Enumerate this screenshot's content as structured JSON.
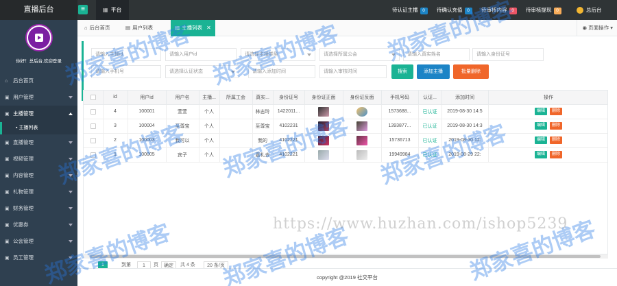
{
  "topbar": {
    "brand": "直播后台",
    "menu_icon": "hamburger-icon",
    "home_tab": "平台",
    "pending": [
      {
        "label": "待认证主播",
        "count": "0",
        "color": "#1c84c6"
      },
      {
        "label": "待确认充值",
        "count": "0",
        "color": "#1c84c6"
      },
      {
        "label": "待审核内容",
        "count": "0",
        "color": "#ed5565"
      },
      {
        "label": "待审核提现",
        "count": "0",
        "color": "#f8ac59"
      }
    ],
    "user": "总后台"
  },
  "sidebar": {
    "welcome": "你好！总后台,欢迎登录",
    "items": [
      {
        "label": "后台首页",
        "icon": "home-icon"
      },
      {
        "label": "用户管理",
        "icon": "user-icon"
      },
      {
        "label": "主播管理",
        "icon": "anchor-icon"
      },
      {
        "label": "直播管理",
        "icon": "live-icon"
      },
      {
        "label": "视频管理",
        "icon": "video-icon"
      },
      {
        "label": "内容管理",
        "icon": "content-icon"
      },
      {
        "label": "礼物管理",
        "icon": "gift-icon"
      },
      {
        "label": "财务管理",
        "icon": "finance-icon"
      },
      {
        "label": "优惠券",
        "icon": "coupon-icon"
      },
      {
        "label": "公会管理",
        "icon": "guild-icon"
      },
      {
        "label": "员工管理",
        "icon": "staff-icon"
      }
    ],
    "sub_item": "主播列表"
  },
  "tabs": [
    {
      "label": "后台首页",
      "icon": "home-icon"
    },
    {
      "label": "用户列表",
      "icon": "list-icon"
    },
    {
      "label": "主播列表",
      "icon": "list-icon"
    }
  ],
  "page_ops": "页面操作",
  "filters": {
    "anchor": "请输入主播id",
    "user": "请输入用户id",
    "type": "请选择主播类型",
    "guild": "请选择所属公会",
    "realname": "请输入真实姓名",
    "idcard": "请输入身份证号",
    "phone": "请输入手机号",
    "status": "请选择认证状态",
    "addtime": "请输入添加时间",
    "audittime": "请输入审核时间"
  },
  "buttons": {
    "search": "搜索",
    "add": "添加主播",
    "delete": "批量删除"
  },
  "table": {
    "headers": [
      "id",
      "用户id",
      "用户名",
      "主播...",
      "所属工会",
      "真实...",
      "身份证号",
      "身份证正面",
      "身份证反面",
      "手机号码",
      "认证...",
      "添加时间",
      "操作"
    ],
    "rows": [
      {
        "id": "4",
        "uid": "100001",
        "name": "萱萱",
        "type": "个人",
        "guild": "",
        "real": "林志玲",
        "idno": "1422011...",
        "phone": "1573688...",
        "status": "已认证",
        "time": "2019-08-30 14:5"
      },
      {
        "id": "3",
        "uid": "100004",
        "name": "至尊宝",
        "type": "个人",
        "guild": "",
        "real": "至尊宝",
        "idno": "4102231",
        "phone": "1393877...",
        "status": "已认证",
        "time": "2019-08-30 14:3"
      },
      {
        "id": "2",
        "uid": "100003",
        "name": "我可以",
        "type": "个人",
        "guild": "",
        "real": "我的",
        "idno": "4102221",
        "phone": "15736713",
        "status": "已认证",
        "time": "2019-08-30 12:"
      },
      {
        "id": "1",
        "uid": "100005",
        "name": "宾子",
        "type": "个人",
        "guild": "",
        "real": "嘉礼去",
        "idno": "4102221",
        "phone": "19949984",
        "status": "已认证",
        "time": "2019-08-29 22:"
      }
    ],
    "edit": "编辑",
    "del": "删除"
  },
  "pager": {
    "current": "1",
    "goto": "到第",
    "page": "1",
    "unit": "页",
    "confirm": "确定",
    "total": "共 4 条",
    "size": "20 条/页"
  },
  "footer": "copyright @2019 社交平台",
  "watermark": {
    "text": "郑家喜的博客",
    "url": "https://www.huzhan.com/ishop5239"
  }
}
